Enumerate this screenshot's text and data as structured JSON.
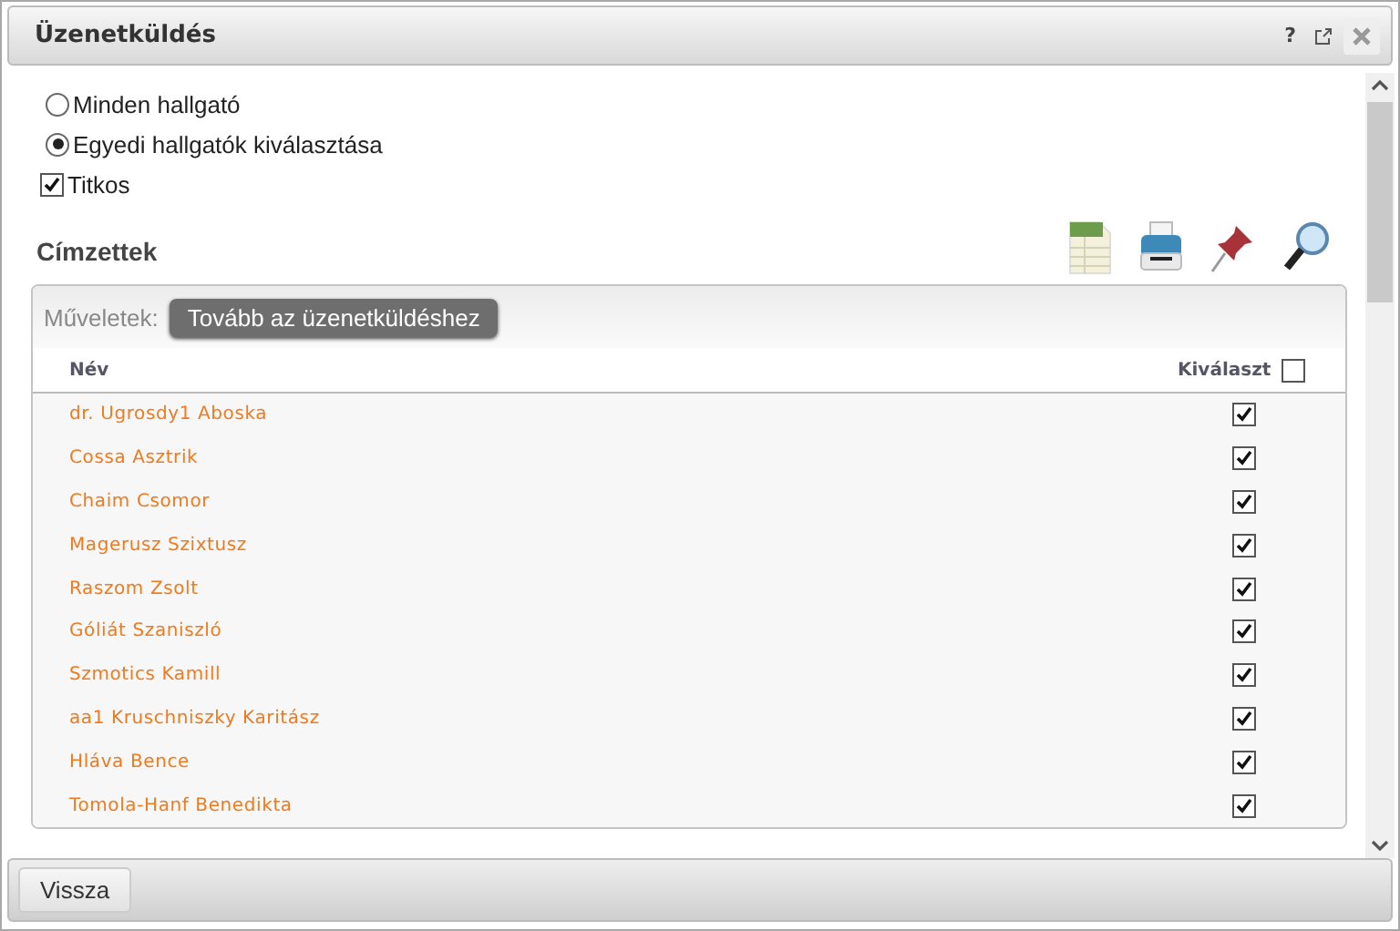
{
  "window": {
    "title": "Üzenetküldés",
    "controls": [
      "?"
    ]
  },
  "recipient_options": [
    {
      "label": "Minden hallgató",
      "selected": false
    },
    {
      "label": "Egyedi hallgatók kiválasztása",
      "selected": true
    }
  ],
  "secret": {
    "label": "Titkos",
    "checked": true
  },
  "section_title": "Címzettek",
  "toolbar": {
    "label": "Műveletek:",
    "button": "Tovább az üzenetküldéshez"
  },
  "table": {
    "columns": [
      {
        "label": "Név"
      },
      {
        "label": "Kiválaszt",
        "checked": false
      }
    ],
    "rows": [
      {
        "name": "dr. Ugrosdy1 Aboska",
        "checked": true
      },
      {
        "name": "Cossa Asztrik",
        "checked": true
      },
      {
        "name": "Chaim Csomor",
        "checked": true
      },
      {
        "name": "Magerusz Szixtusz",
        "checked": true
      },
      {
        "name": "Raszom Zsolt",
        "checked": true
      },
      {
        "name": "Góliát Szaniszló",
        "checked": true
      },
      {
        "name": "Szmotics Kamill",
        "checked": true
      },
      {
        "name": "aa1 Kruschniszky Karitász",
        "checked": true
      },
      {
        "name": "Hláva Bence",
        "checked": true
      },
      {
        "name": "Tomola-Hanf Benedikta",
        "checked": true
      }
    ]
  },
  "footer": {
    "button": "Vissza"
  }
}
